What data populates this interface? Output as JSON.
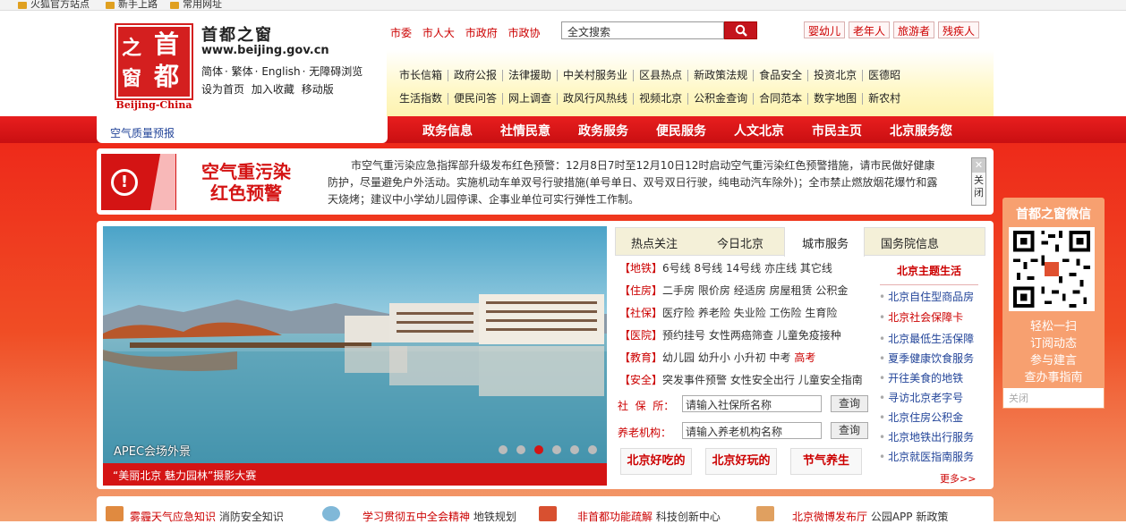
{
  "bookmarks": [
    {
      "label": "火狐官方站点"
    },
    {
      "label": "新手上路"
    },
    {
      "label": "常用网址"
    }
  ],
  "header": {
    "logo_chars": [
      "之",
      "首",
      "窗",
      "都"
    ],
    "logo_en": "Beijing-China",
    "site_name": "首都之窗",
    "site_url": "www.beijing.gov.cn",
    "lang_links": [
      "简体",
      "繁体",
      "English",
      "无障碍浏览"
    ],
    "util_links": [
      "设为首页",
      "加入收藏",
      "移动版"
    ],
    "top_nav": [
      "市委",
      "市人大",
      "市政府",
      "市政协"
    ],
    "search_placeholder": "全文搜索",
    "audiences": [
      "婴幼儿",
      "老年人",
      "旅游者",
      "残疾人"
    ],
    "links_row1": [
      "市长信箱",
      "政府公报",
      "法律援助",
      "中关村服务业",
      "区县热点",
      "新政策法规",
      "食品安全",
      "投资北京",
      "医德昭"
    ],
    "links_row2": [
      "生活指数",
      "便民问答",
      "网上调查",
      "政风行风热线",
      "视频北京",
      "公积金查询",
      "合同范本",
      "数字地图",
      "新农村"
    ],
    "air_quality": "空气质量预报",
    "main_nav": [
      "政务信息",
      "社情民意",
      "政务服务",
      "便民服务",
      "人文北京",
      "市民主页",
      "北京服务您"
    ]
  },
  "alert": {
    "title_line1": "空气重污染",
    "title_line2": "红色预警",
    "text": "市空气重污染应急指挥部升级发布红色预警：12月8日7时至12月10日12时启动空气重污染红色预警措施，请市民做好健康防护，尽量避免户外活动。实施机动车单双号行驶措施(单号单日、双号双日行驶，纯电动汽车除外)；全市禁止燃放烟花爆竹和露天烧烤；建议中小学幼儿园停课、企事业单位可实行弹性工作制。",
    "close_label": "关闭"
  },
  "slideshow": {
    "caption": "APEC会场外景",
    "bar_text": "“美丽北京 魅力园林”摄影大赛",
    "dot_count": 6,
    "active_index": 2
  },
  "tabs": [
    "热点关注",
    "今日北京",
    "城市服务",
    "国务院信息"
  ],
  "active_tab": "城市服务",
  "categories": [
    {
      "key": "【地铁】",
      "items": [
        "6号线",
        "8号线",
        "14号线",
        "亦庄线",
        "其它线"
      ]
    },
    {
      "key": "【住房】",
      "items": [
        "二手房",
        "限价房",
        "经适房",
        "房屋租赁",
        "公积金"
      ]
    },
    {
      "key": "【社保】",
      "items": [
        "医疗险",
        "养老险",
        "失业险",
        "工伤险",
        "生育险"
      ]
    },
    {
      "key": "【医院】",
      "items": [
        "预约挂号",
        "女性两癌筛查",
        "儿童免疫接种"
      ]
    },
    {
      "key": "【教育】",
      "items": [
        "幼儿园",
        "幼升小",
        "小升初",
        "中考",
        "高考"
      ]
    },
    {
      "key": "【安全】",
      "items": [
        "突发事件预警",
        "女性安全出行",
        "儿童安全指南"
      ]
    }
  ],
  "query": {
    "shebao_label": "社  保  所：",
    "shebao_placeholder": "请输入社保所名称",
    "yanglao_label": "养老机构：",
    "yanglao_placeholder": "请输入养老机构名称",
    "button": "查询"
  },
  "pills": [
    "北京好吃的",
    "北京好玩的",
    "节气养生"
  ],
  "theme": {
    "title": "北京主题生活",
    "items": [
      "北京自住型商品房",
      "北京社会保障卡",
      "北京最低生活保障",
      "夏季健康饮食服务",
      "开往美食的地铁",
      "寻访北京老字号",
      "北京住房公积金",
      "北京地铁出行服务",
      "北京就医指南服务"
    ],
    "more": "更多>>"
  },
  "wechat": {
    "title": "首都之窗微信",
    "lines": [
      "轻松一扫",
      "订阅动态",
      "参与建言",
      "查办事指南"
    ],
    "close": "关闭"
  },
  "bottom": [
    {
      "a": "雾霾天气应急知识",
      "b": "消防安全知识"
    },
    {
      "a": "学习贯彻五中全会精神",
      "b": "地铁规划"
    },
    {
      "a": "非首都功能疏解",
      "b": "科技创新中心"
    },
    {
      "a": "北京微博发布厅",
      "b": "公园APP",
      "c": "新政策"
    }
  ],
  "colors": {
    "brand_red": "#d41414",
    "link_blue": "#224499",
    "panel_yellow": "#fff8c8",
    "wechat_orange": "#f7a070"
  }
}
